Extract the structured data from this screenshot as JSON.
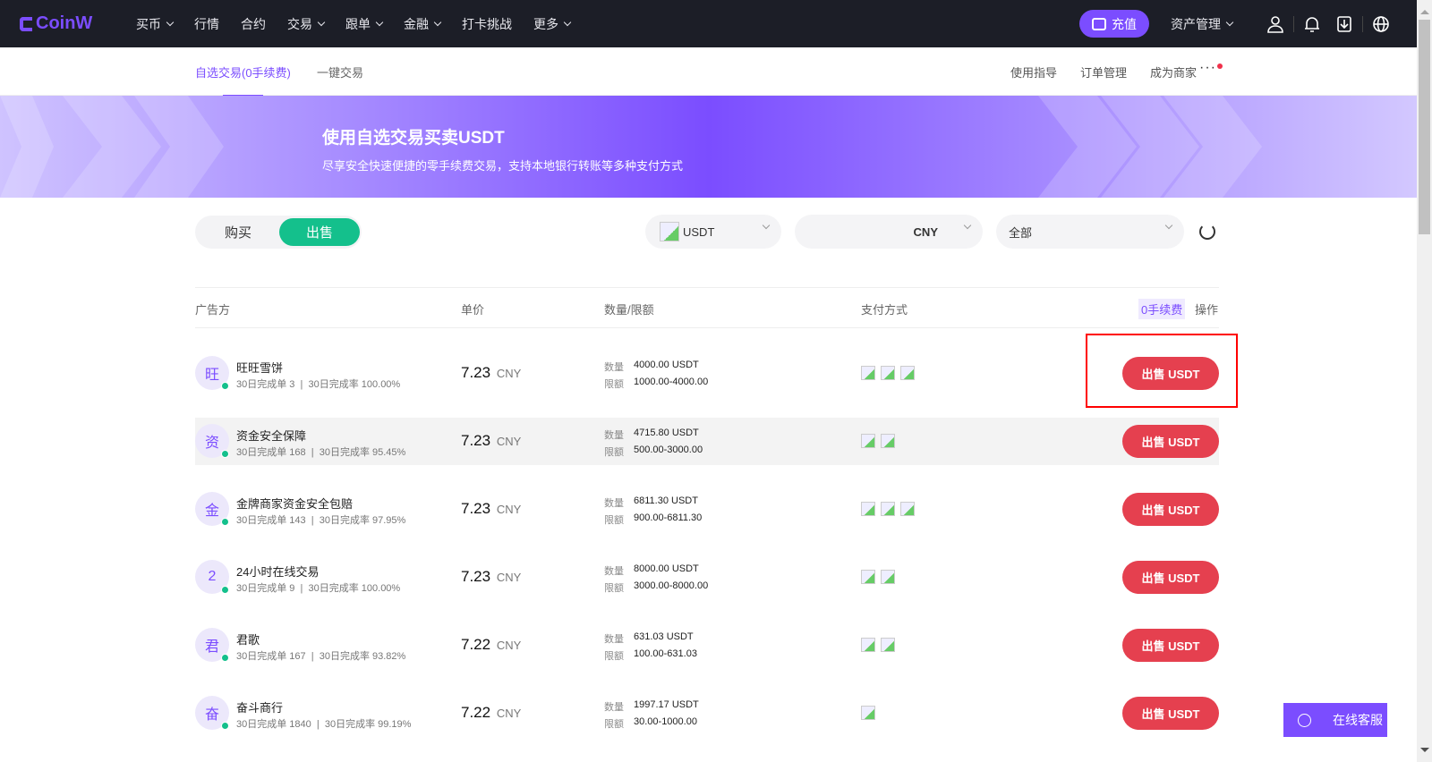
{
  "brand": "CoinW",
  "nav": {
    "items": [
      {
        "label": "买币",
        "dd": true
      },
      {
        "label": "行情",
        "dd": false
      },
      {
        "label": "合约",
        "dd": false
      },
      {
        "label": "交易",
        "dd": true
      },
      {
        "label": "跟单",
        "dd": true
      },
      {
        "label": "金融",
        "dd": true
      },
      {
        "label": "打卡挑战",
        "dd": false
      },
      {
        "label": "更多",
        "dd": true
      }
    ],
    "deposit": "充值",
    "assets": "资产管理"
  },
  "subnav": {
    "tabs": [
      "自选交易(0手续费)",
      "一键交易"
    ],
    "links": [
      "使用指导",
      "订单管理",
      "成为商家"
    ],
    "more": "···"
  },
  "banner": {
    "title": "使用自选交易买卖USDT",
    "subtitle": "尽享安全快速便捷的零手续费交易，支持本地银行转账等多种支付方式"
  },
  "filters": {
    "buy": "购买",
    "sell": "出售",
    "coin": "USDT",
    "fiat": "CNY",
    "payment": "全部"
  },
  "table": {
    "headers": {
      "advertiser": "广告方",
      "price": "单价",
      "amount": "数量/限额",
      "payment": "支付方式",
      "zero_fee": "0手续费",
      "action": "操作"
    },
    "qty_label": "数量",
    "limit_label": "限额",
    "rows": [
      {
        "avatar": "旺",
        "name": "旺旺雪饼",
        "stats": "30日完成单 3  |  30日完成率 100.00%",
        "price": "7.23",
        "currency": "CNY",
        "qty": "4000.00 USDT",
        "limit": "1000.00-4000.00",
        "pay_count": 3,
        "action": "出售 USDT"
      },
      {
        "avatar": "资",
        "name": "资金安全保障",
        "stats": "30日完成单 168  |  30日完成率 95.45%",
        "price": "7.23",
        "currency": "CNY",
        "qty": "4715.80 USDT",
        "limit": "500.00-3000.00",
        "pay_count": 2,
        "action": "出售 USDT"
      },
      {
        "avatar": "金",
        "name": "金牌商家资金安全包赔",
        "stats": "30日完成单 143  |  30日完成率 97.95%",
        "price": "7.23",
        "currency": "CNY",
        "qty": "6811.30 USDT",
        "limit": "900.00-6811.30",
        "pay_count": 3,
        "action": "出售 USDT"
      },
      {
        "avatar": "2",
        "name": "24小时在线交易",
        "stats": "30日完成单 9  |  30日完成率 100.00%",
        "price": "7.23",
        "currency": "CNY",
        "qty": "8000.00 USDT",
        "limit": "3000.00-8000.00",
        "pay_count": 2,
        "action": "出售 USDT"
      },
      {
        "avatar": "君",
        "name": "君歌",
        "stats": "30日完成单 167  |  30日完成率 93.82%",
        "price": "7.22",
        "currency": "CNY",
        "qty": "631.03 USDT",
        "limit": "100.00-631.03",
        "pay_count": 2,
        "action": "出售 USDT"
      },
      {
        "avatar": "奋",
        "name": "奋斗商行",
        "stats": "30日完成单 1840  |  30日完成率 99.19%",
        "price": "7.22",
        "currency": "CNY",
        "qty": "1997.17 USDT",
        "limit": "30.00-1000.00",
        "pay_count": 1,
        "action": "出售 USDT"
      }
    ]
  },
  "support": "在线客服"
}
